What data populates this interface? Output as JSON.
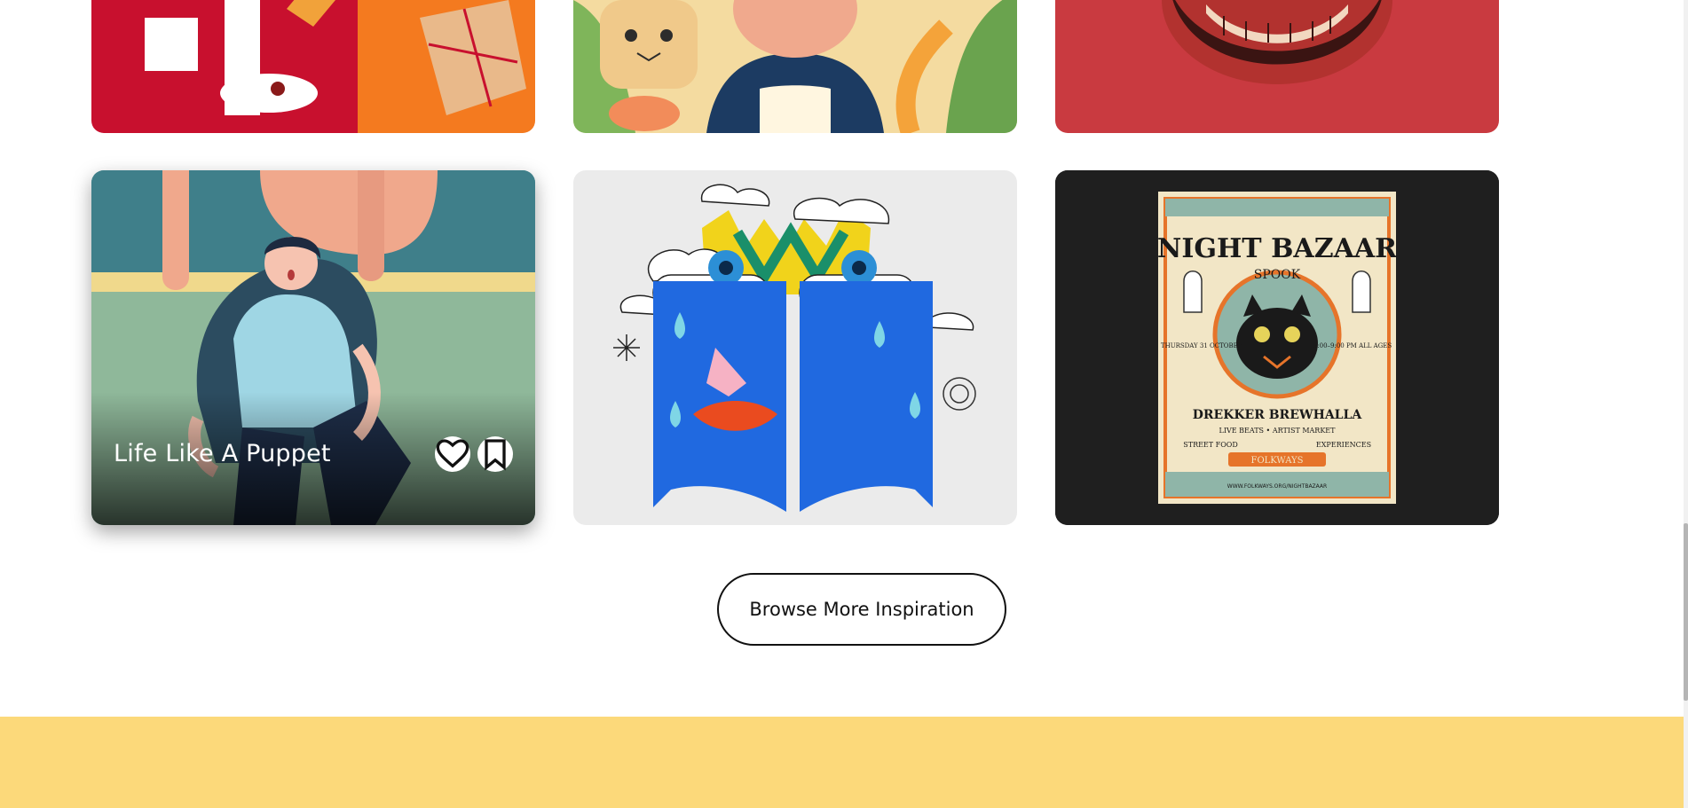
{
  "gallery": {
    "cards": [
      {
        "image": "sneaker-basketball-illustration"
      },
      {
        "image": "cat-toast-portrait-illustration"
      },
      {
        "image": "grinning-face-illustration"
      },
      {
        "image": "puppet-man-in-chair-illustration",
        "title": "Life Like A Puppet",
        "actions": [
          {
            "icon": "heart-icon"
          },
          {
            "icon": "bookmark-icon"
          }
        ]
      },
      {
        "image": "crying-blue-face-illustration"
      },
      {
        "image": "night-bazaar-poster",
        "poster": {
          "title": "NIGHT BAZAAR",
          "subtitle": "SPOOK",
          "date_left": "THURSDAY 31 OCTOBER",
          "time_right": "5:00–9:00 PM ALL AGES",
          "venue": "DREKKER BREWHALLA",
          "features": "LIVE BEATS • ARTIST MARKET",
          "left_note": "STREET FOOD",
          "right_note": "EXPERIENCES",
          "brand": "FOLKWAYS",
          "url": "WWW.FOLKWAYS.ORG/NIGHTBAZAAR"
        }
      }
    ]
  },
  "browse_button": {
    "label": "Browse More Inspiration"
  },
  "colors": {
    "footer_band": "#fcd97a",
    "card_dark": "#1f1f1f",
    "accent_red": "#c93a40"
  }
}
